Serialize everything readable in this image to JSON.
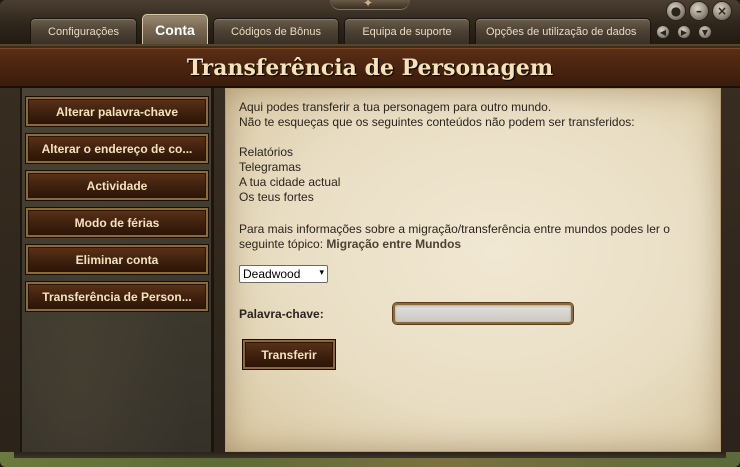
{
  "tabs": [
    {
      "label": "Configurações",
      "active": false
    },
    {
      "label": "Conta",
      "active": true
    },
    {
      "label": "Códigos de Bônus",
      "active": false
    },
    {
      "label": "Equipa de suporte",
      "active": false
    },
    {
      "label": "Opções de utilização de dados",
      "active": false
    }
  ],
  "window_controls": {
    "top": [
      "ok-circle-icon",
      "minimize-icon",
      "close-icon"
    ],
    "top_glyphs": [
      "●",
      "–",
      "×"
    ],
    "nav": [
      "arrow-left-icon",
      "arrow-right-icon",
      "arrow-down-icon"
    ],
    "nav_glyphs": [
      "◀",
      "▶",
      "▼"
    ]
  },
  "header": {
    "title": "Transferência de Personagem"
  },
  "sidebar": {
    "items": [
      {
        "label": "Alterar palavra-chave"
      },
      {
        "label": "Alterar o endereço de co..."
      },
      {
        "label": "Actividade"
      },
      {
        "label": "Modo de férias"
      },
      {
        "label": "Eliminar conta"
      },
      {
        "label": "Transferência de Person..."
      }
    ]
  },
  "main": {
    "intro_line1": "Aqui podes transferir a tua personagem para outro mundo.",
    "intro_line2": "Não te esqueças que os seguintes conteúdos não podem ser transferidos:",
    "non_transferable": [
      "Relatórios",
      "Telegramas",
      "A tua cidade actual",
      "Os teus fortes"
    ],
    "info_text": "Para mais informações sobre a migração/transferência entre mundos podes ler o seguinte tópico:",
    "info_link": "Migração entre Mundos",
    "world_select": {
      "selected": "Deadwood"
    },
    "password_label": "Palavra-chave:",
    "password_value": "",
    "transfer_button": "Transferir"
  },
  "colors": {
    "banner": "#4a2410",
    "button_text": "#f3e4bd",
    "parchment": "#e9dec4",
    "button_border": "#8c6a3a"
  }
}
